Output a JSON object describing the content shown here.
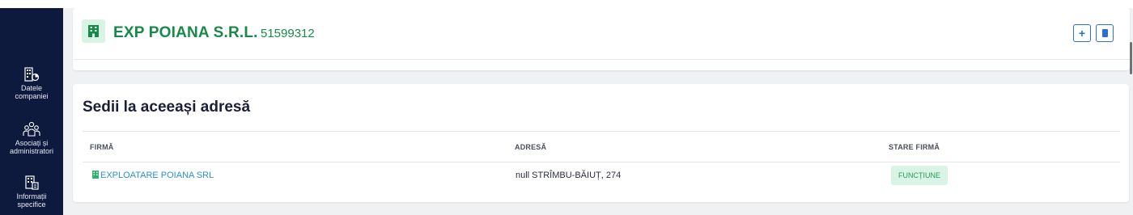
{
  "sidebar": {
    "items": [
      {
        "label1": "Datele",
        "label2": "companiei",
        "icon": "building-chart-icon"
      },
      {
        "label1": "Asociați și",
        "label2": "administratori",
        "icon": "people-group-icon"
      },
      {
        "label1": "Informații",
        "label2": "specifice",
        "icon": "building-document-icon"
      }
    ]
  },
  "header": {
    "company_name": "EXP POIANA S.R.L.",
    "cui": "51599312",
    "add_button_label": "+"
  },
  "section": {
    "title": "Sedii la aceeași adresă",
    "columns": [
      "FIRMĂ",
      "ADRESĂ",
      "STARE FIRMĂ"
    ],
    "rows": [
      {
        "firma": "EXPLOATARE POIANA SRL",
        "adresa": "null STRÎMBU-BĂIUȚ, 274",
        "stare": "FUNCȚIUNE"
      }
    ]
  },
  "colors": {
    "sidebar_bg": "#0e1a3d",
    "brand_green": "#178a49",
    "link_blue": "#2c8fd6",
    "badge_bg": "#d9f3e4",
    "button_blue": "#2c6ed5"
  }
}
